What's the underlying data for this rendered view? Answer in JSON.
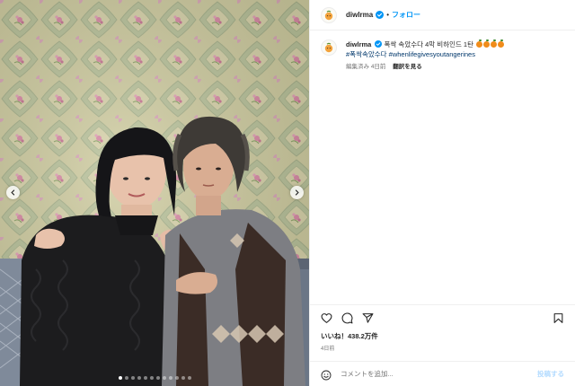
{
  "post": {
    "username": "diwlrma",
    "follow_label": "フォロー",
    "separator": "•",
    "caption": {
      "username": "diwlrma",
      "text": "폭싹 속았수다 4막 비하인드 1탄",
      "emoji_count": 4,
      "hashtags": "#폭싹속았수다 #whenlifegivesyoutangerines"
    },
    "meta": {
      "edited": "編集済み",
      "age": "4日前",
      "translate_label": "翻訳を見る"
    },
    "likes_label": "いいね！438.2万件",
    "date_label": "4日前",
    "comment": {
      "placeholder": "コメントを追加...",
      "post_label": "投稿する"
    },
    "carousel": {
      "total_slides": 12,
      "active_index": 0
    },
    "icons": [
      "heart-icon",
      "comment-icon",
      "share-icon",
      "bookmark-icon",
      "emoji-icon",
      "verified-icon",
      "chevron-left-icon",
      "chevron-right-icon"
    ],
    "colors": {
      "accent": "#0095f6",
      "hashtag": "#00376b",
      "post_disabled": "#b3dbff"
    }
  }
}
